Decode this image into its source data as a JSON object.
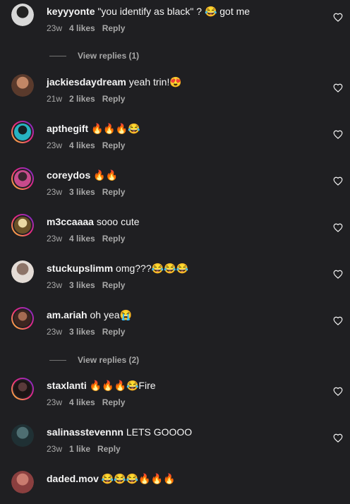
{
  "comments": [
    {
      "username": "keyyyonte",
      "text": "\"you identify as black\" ? 😂 got me",
      "time": "23w",
      "likes": "4 likes",
      "reply": "Reply",
      "avatar": {
        "ring": false,
        "bg": "#d8d8d8",
        "fg": "#222222"
      }
    },
    {
      "username": "jackiesdaydream",
      "text": "yeah trin!😍",
      "time": "21w",
      "likes": "2 likes",
      "reply": "Reply",
      "avatar": {
        "ring": false,
        "bg": "#5a3a2c",
        "fg": "#c28766"
      }
    },
    {
      "username": "apthegift",
      "text": "🔥🔥🔥😂",
      "time": "23w",
      "likes": "4 likes",
      "reply": "Reply",
      "avatar": {
        "ring": true,
        "bg": "#27b3c2",
        "fg": "#132124"
      }
    },
    {
      "username": "coreydos",
      "text": "🔥🔥",
      "time": "23w",
      "likes": "3 likes",
      "reply": "Reply",
      "avatar": {
        "ring": true,
        "bg": "#c84a8c",
        "fg": "#38252f"
      }
    },
    {
      "username": "m3ccaaaa",
      "text": "sooo cute",
      "time": "23w",
      "likes": "4 likes",
      "reply": "Reply",
      "avatar": {
        "ring": true,
        "bg": "#6b5228",
        "fg": "#e9d7a3"
      }
    },
    {
      "username": "stuckupslimm",
      "text": "omg???😂😂😂",
      "time": "23w",
      "likes": "3 likes",
      "reply": "Reply",
      "avatar": {
        "ring": false,
        "bg": "#e4dcd6",
        "fg": "#8d7468"
      }
    },
    {
      "username": "am.ariah",
      "text": "oh yea😭",
      "time": "23w",
      "likes": "3 likes",
      "reply": "Reply",
      "avatar": {
        "ring": true,
        "bg": "#3d2620",
        "fg": "#a56b52"
      }
    },
    {
      "username": "staxlanti",
      "text": "🔥🔥🔥😂Fire",
      "time": "23w",
      "likes": "4 likes",
      "reply": "Reply",
      "avatar": {
        "ring": true,
        "bg": "#1c1414",
        "fg": "#5a3a3a"
      }
    },
    {
      "username": "salinasstevennn",
      "text": "LETS GOOOO",
      "time": "23w",
      "likes": "1 like",
      "reply": "Reply",
      "avatar": {
        "ring": false,
        "bg": "#1f3034",
        "fg": "#4e6e72"
      }
    },
    {
      "username": "daded.mov",
      "text": "😂😂😂🔥🔥🔥",
      "time": "",
      "likes": "",
      "reply": "",
      "avatar": {
        "ring": false,
        "bg": "#8a3f3f",
        "fg": "#c97b6f"
      }
    }
  ],
  "view_replies_1": "View replies (1)",
  "view_replies_2": "View replies (2)",
  "icons": {
    "like": "heart-outline-icon"
  }
}
